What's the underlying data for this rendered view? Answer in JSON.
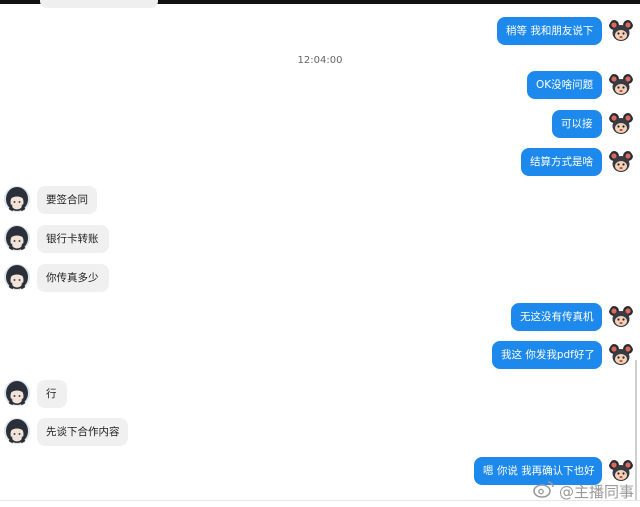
{
  "conversation": {
    "timestamp": "12:04:00",
    "messages": [
      {
        "dir": "out",
        "text": "稍等 我和朋友说下"
      },
      {
        "dir": "out",
        "text": "OK没啥问题"
      },
      {
        "dir": "out",
        "text": "可以接"
      },
      {
        "dir": "out",
        "text": "结算方式是啥"
      },
      {
        "dir": "in",
        "text": "要签合同"
      },
      {
        "dir": "in",
        "text": "银行卡转账"
      },
      {
        "dir": "in",
        "text": "你传真多少"
      },
      {
        "dir": "out",
        "text": "无这没有传真机"
      },
      {
        "dir": "out",
        "text": "我这 你发我pdf好了"
      },
      {
        "dir": "in",
        "text": "行"
      },
      {
        "dir": "in",
        "text": "先谈下合作内容"
      },
      {
        "dir": "out",
        "text": "嗯 你说 我再确认下也好"
      }
    ]
  },
  "watermark": {
    "text": "@主播同事"
  },
  "icons": {
    "self_avatar": "cartoon-mouse-avatar-icon",
    "peer_avatar": "anime-girl-avatar-icon",
    "watermark": "weibo-logo-icon"
  },
  "colors": {
    "outgoing_bubble": "#1d89ec",
    "incoming_bubble": "#f0f0f0"
  }
}
